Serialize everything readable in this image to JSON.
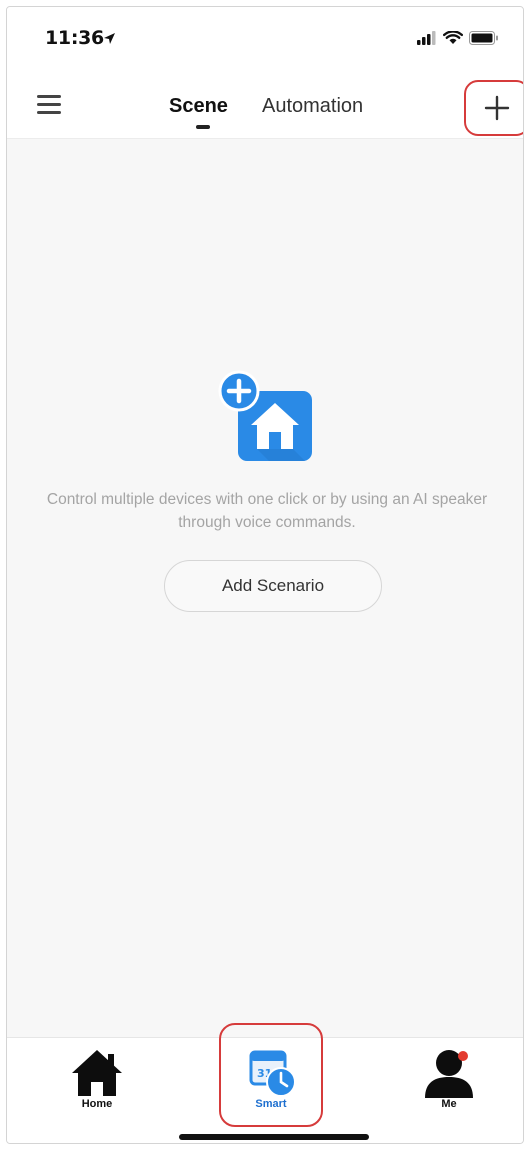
{
  "status_bar": {
    "time": "11:36",
    "icons": [
      "location-arrow-icon",
      "signal-icon",
      "wifi-icon",
      "battery-icon"
    ]
  },
  "header": {
    "menu_icon": "hamburger-menu-icon",
    "tabs": [
      {
        "label": "Scene",
        "active": true
      },
      {
        "label": "Automation",
        "active": false
      }
    ],
    "add_icon": "plus-icon"
  },
  "empty_state": {
    "illustration_icon": "add-home-icon",
    "message": "Control multiple devices with one click or by using an AI speaker through voice commands.",
    "button_label": "Add Scenario"
  },
  "tab_bar": {
    "items": [
      {
        "label": "Home",
        "icon": "home-icon",
        "active": false
      },
      {
        "label": "Smart",
        "icon": "smart-calendar-clock-icon",
        "active": true
      },
      {
        "label": "Me",
        "icon": "person-icon",
        "active": false
      }
    ]
  },
  "colors": {
    "accent": "#2a8ae6",
    "highlight_outline": "#d63b3b",
    "muted_text": "#a4a4a4"
  }
}
